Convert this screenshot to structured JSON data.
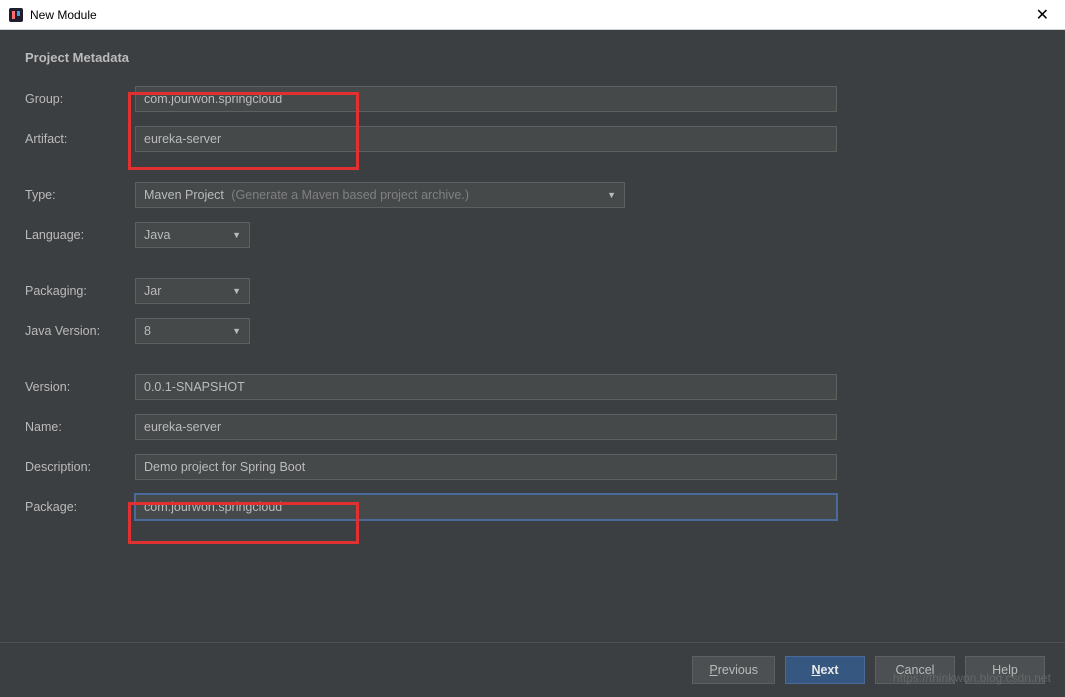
{
  "window": {
    "title": "New Module"
  },
  "section": {
    "title": "Project Metadata"
  },
  "labels": {
    "group": "Group:",
    "artifact": "Artifact:",
    "type": "Type:",
    "language": "Language:",
    "packaging": "Packaging:",
    "javaVersion": "Java Version:",
    "version": "Version:",
    "name": "Name:",
    "description": "Description:",
    "package": "Package:"
  },
  "values": {
    "group": "com.jourwon.springcloud",
    "artifact": "eureka-server",
    "type": "Maven Project",
    "typeHint": "(Generate a Maven based project archive.)",
    "language": "Java",
    "packaging": "Jar",
    "javaVersion": "8",
    "version": "0.0.1-SNAPSHOT",
    "name": "eureka-server",
    "description": "Demo project for Spring Boot",
    "package": "com.jourwon.springcloud"
  },
  "buttons": {
    "previous": "Previous",
    "next": "Next",
    "cancel": "Cancel",
    "help": "Help"
  },
  "watermark": "https://thinkwon.blog.csdn.net"
}
